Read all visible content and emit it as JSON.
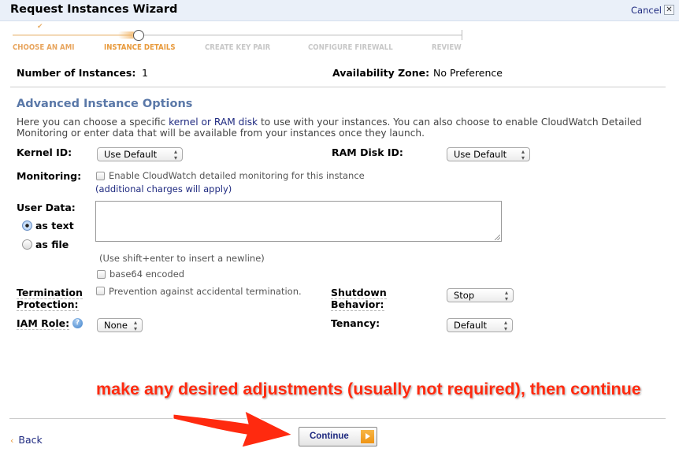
{
  "window": {
    "title": "Request Instances Wizard",
    "cancel_label": "Cancel",
    "close_glyph": "✕"
  },
  "wizard_steps": [
    {
      "label": "CHOOSE AN AMI",
      "state": "done"
    },
    {
      "label": "INSTANCE DETAILS",
      "state": "active"
    },
    {
      "label": "CREATE KEY PAIR",
      "state": "todo"
    },
    {
      "label": "CONFIGURE FIREWALL",
      "state": "todo"
    },
    {
      "label": "REVIEW",
      "state": "todo"
    }
  ],
  "step_check_glyph": "✔",
  "summary": {
    "instances_label": "Number of Instances:",
    "instances_value": "1",
    "zone_label": "Availability Zone:",
    "zone_value": "No Preference"
  },
  "advanced": {
    "title": "Advanced Instance Options",
    "desc_before": "Here you can choose a specific ",
    "desc_link": "kernel or RAM disk",
    "desc_after": " to use with your instances. You can also choose to enable CloudWatch Detailed Monitoring or enter data that will be available from your instances once they launch.",
    "kernel_label": "Kernel ID:",
    "kernel_value": "Use Default",
    "ramdisk_label": "RAM Disk ID:",
    "ramdisk_value": "Use Default",
    "monitoring_label": "Monitoring:",
    "monitoring_checkbox": "Enable CloudWatch detailed monitoring for this instance",
    "monitoring_checked": false,
    "monitoring_note": "(additional charges will apply)",
    "userdata_label": "User Data:",
    "userdata_value": "",
    "as_text_label": "as text",
    "as_file_label": "as file",
    "userdata_mode": "as text",
    "newline_hint": "(Use shift+enter to insert a newline)",
    "base64_label": "base64 encoded",
    "base64_checked": false,
    "termination_label_1": "Termination",
    "termination_label_2": "Protection:",
    "termination_checkbox": "Prevention against accidental termination.",
    "termination_checked": false,
    "shutdown_label_1": "Shutdown",
    "shutdown_label_2": "Behavior:",
    "shutdown_value": "Stop",
    "iam_label": "IAM Role:",
    "iam_help_glyph": "?",
    "iam_value": "None",
    "tenancy_label": "Tenancy:",
    "tenancy_value": "Default"
  },
  "footer": {
    "back_glyph": "‹",
    "back_label": "Back",
    "continue_label": "Continue"
  },
  "annotation": {
    "text": "make any desired adjustments (usually not required), then continue",
    "color": "#ff2a0f"
  },
  "colors": {
    "accent_orange": "#e89a3c",
    "link_blue": "#1f2a80",
    "section_blue": "#5a78a8",
    "titlebar_bg": "#eaf0f9"
  }
}
